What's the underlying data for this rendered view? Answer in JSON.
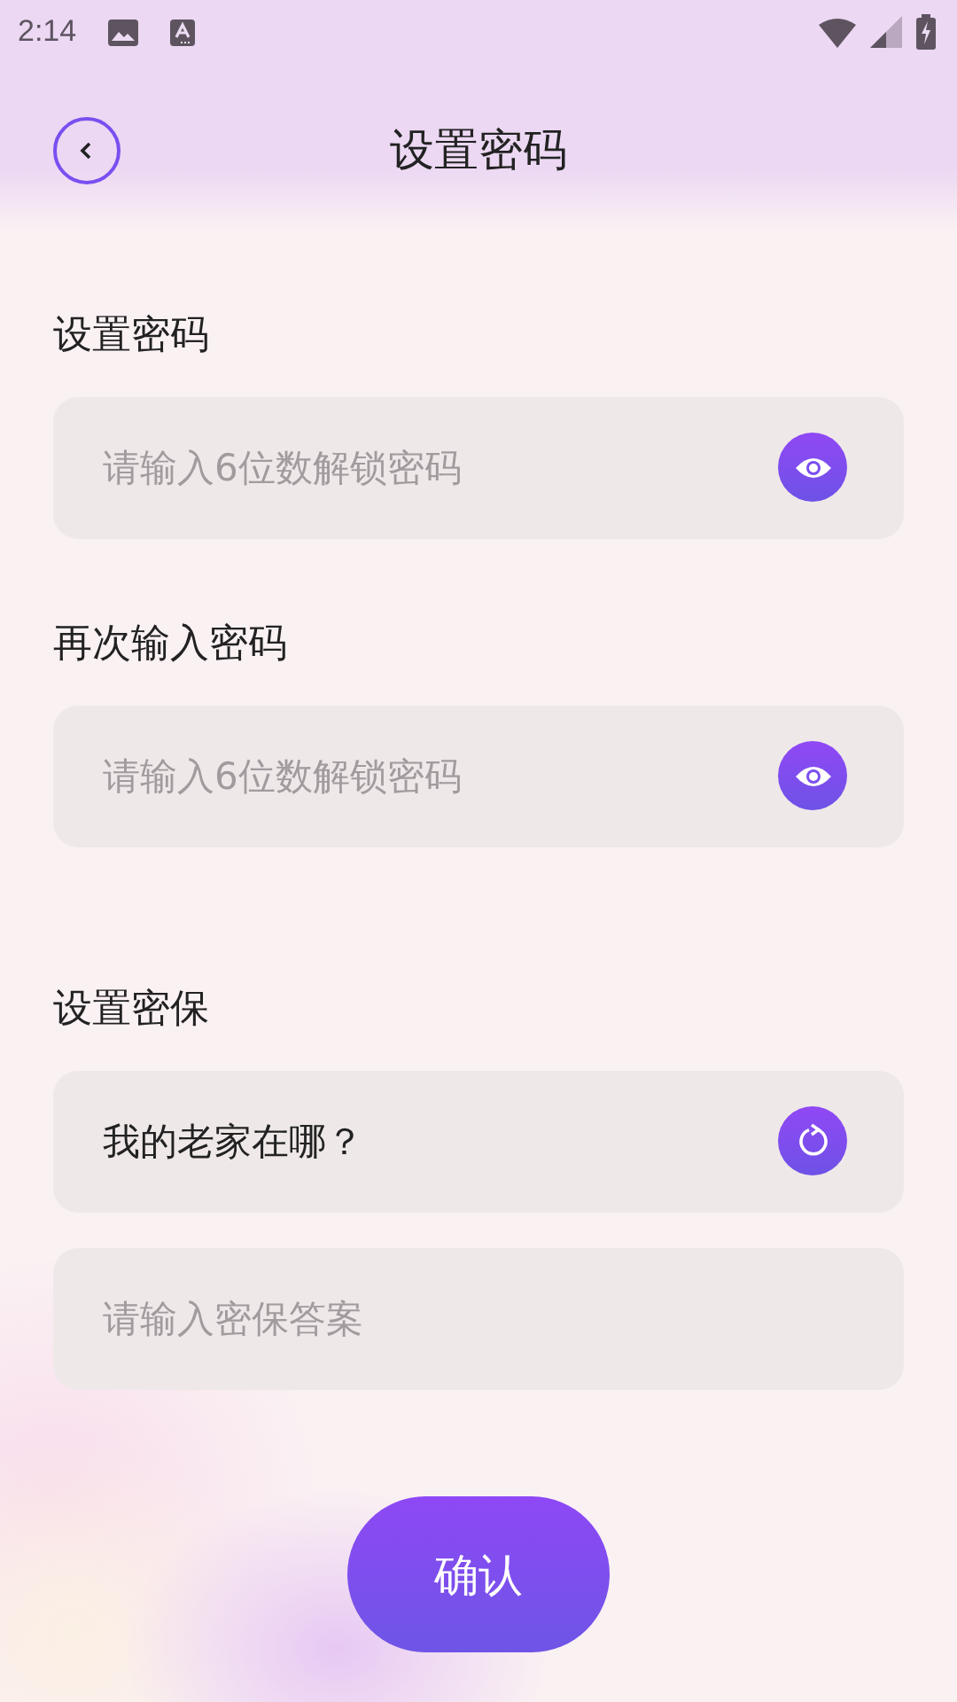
{
  "status_bar": {
    "time": "2:14"
  },
  "header": {
    "title": "设置密码"
  },
  "sections": [
    {
      "label": "设置密码",
      "fields": [
        {
          "kind": "password",
          "placeholder": "请输入6位数解锁密码"
        }
      ]
    },
    {
      "label": "再次输入密码",
      "fields": [
        {
          "kind": "password",
          "placeholder": "请输入6位数解锁密码"
        }
      ]
    },
    {
      "label": "设置密保",
      "fields": [
        {
          "kind": "question",
          "value": "我的老家在哪？"
        },
        {
          "kind": "answer",
          "placeholder": "请输入密保答案"
        }
      ]
    }
  ],
  "confirm_button": "确认"
}
